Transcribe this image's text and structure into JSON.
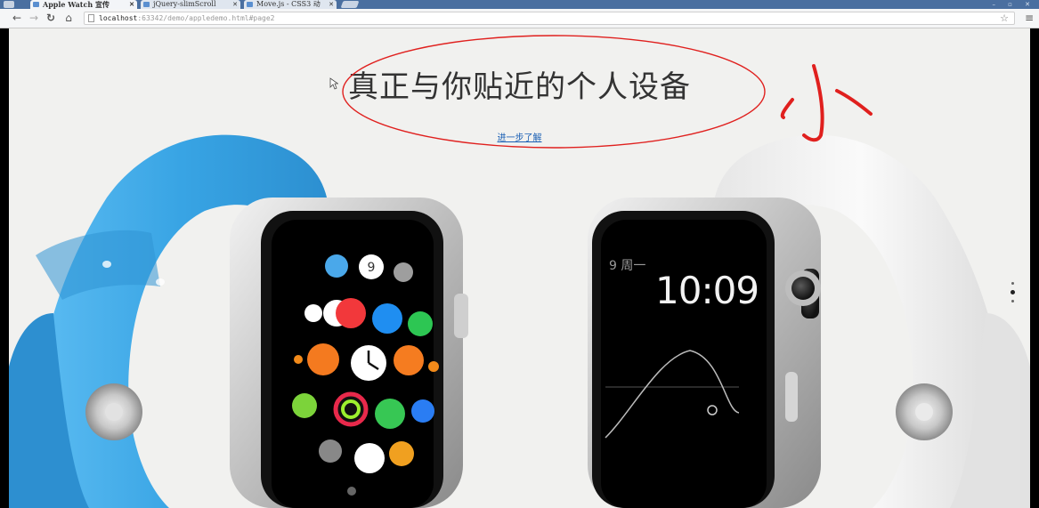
{
  "browser": {
    "tabs": [
      {
        "label": "Apple Watch 宣传",
        "active": true
      },
      {
        "label": "jQuery-slimScroll",
        "active": false
      },
      {
        "label": "Move.js - CSS3 动",
        "active": false
      }
    ],
    "url_host": "localhost",
    "url_rest": ":63342/demo/appledemo.html#page2"
  },
  "page": {
    "headline": "真正与你贴近的个人设备",
    "learn_more": "进一步了解",
    "watch_right": {
      "date": "9 周一",
      "time": "10:09"
    },
    "app_icon_clock": "9"
  },
  "annotation": {
    "handwriting": "小",
    "ink_color": "#e0201e"
  },
  "colors": {
    "band_blue": "#3aa3e3",
    "band_white": "#f4f4f4",
    "page_bg": "#f1f1ef",
    "link": "#1a5fb4"
  },
  "pager": {
    "count": 3,
    "active_index": 1
  }
}
